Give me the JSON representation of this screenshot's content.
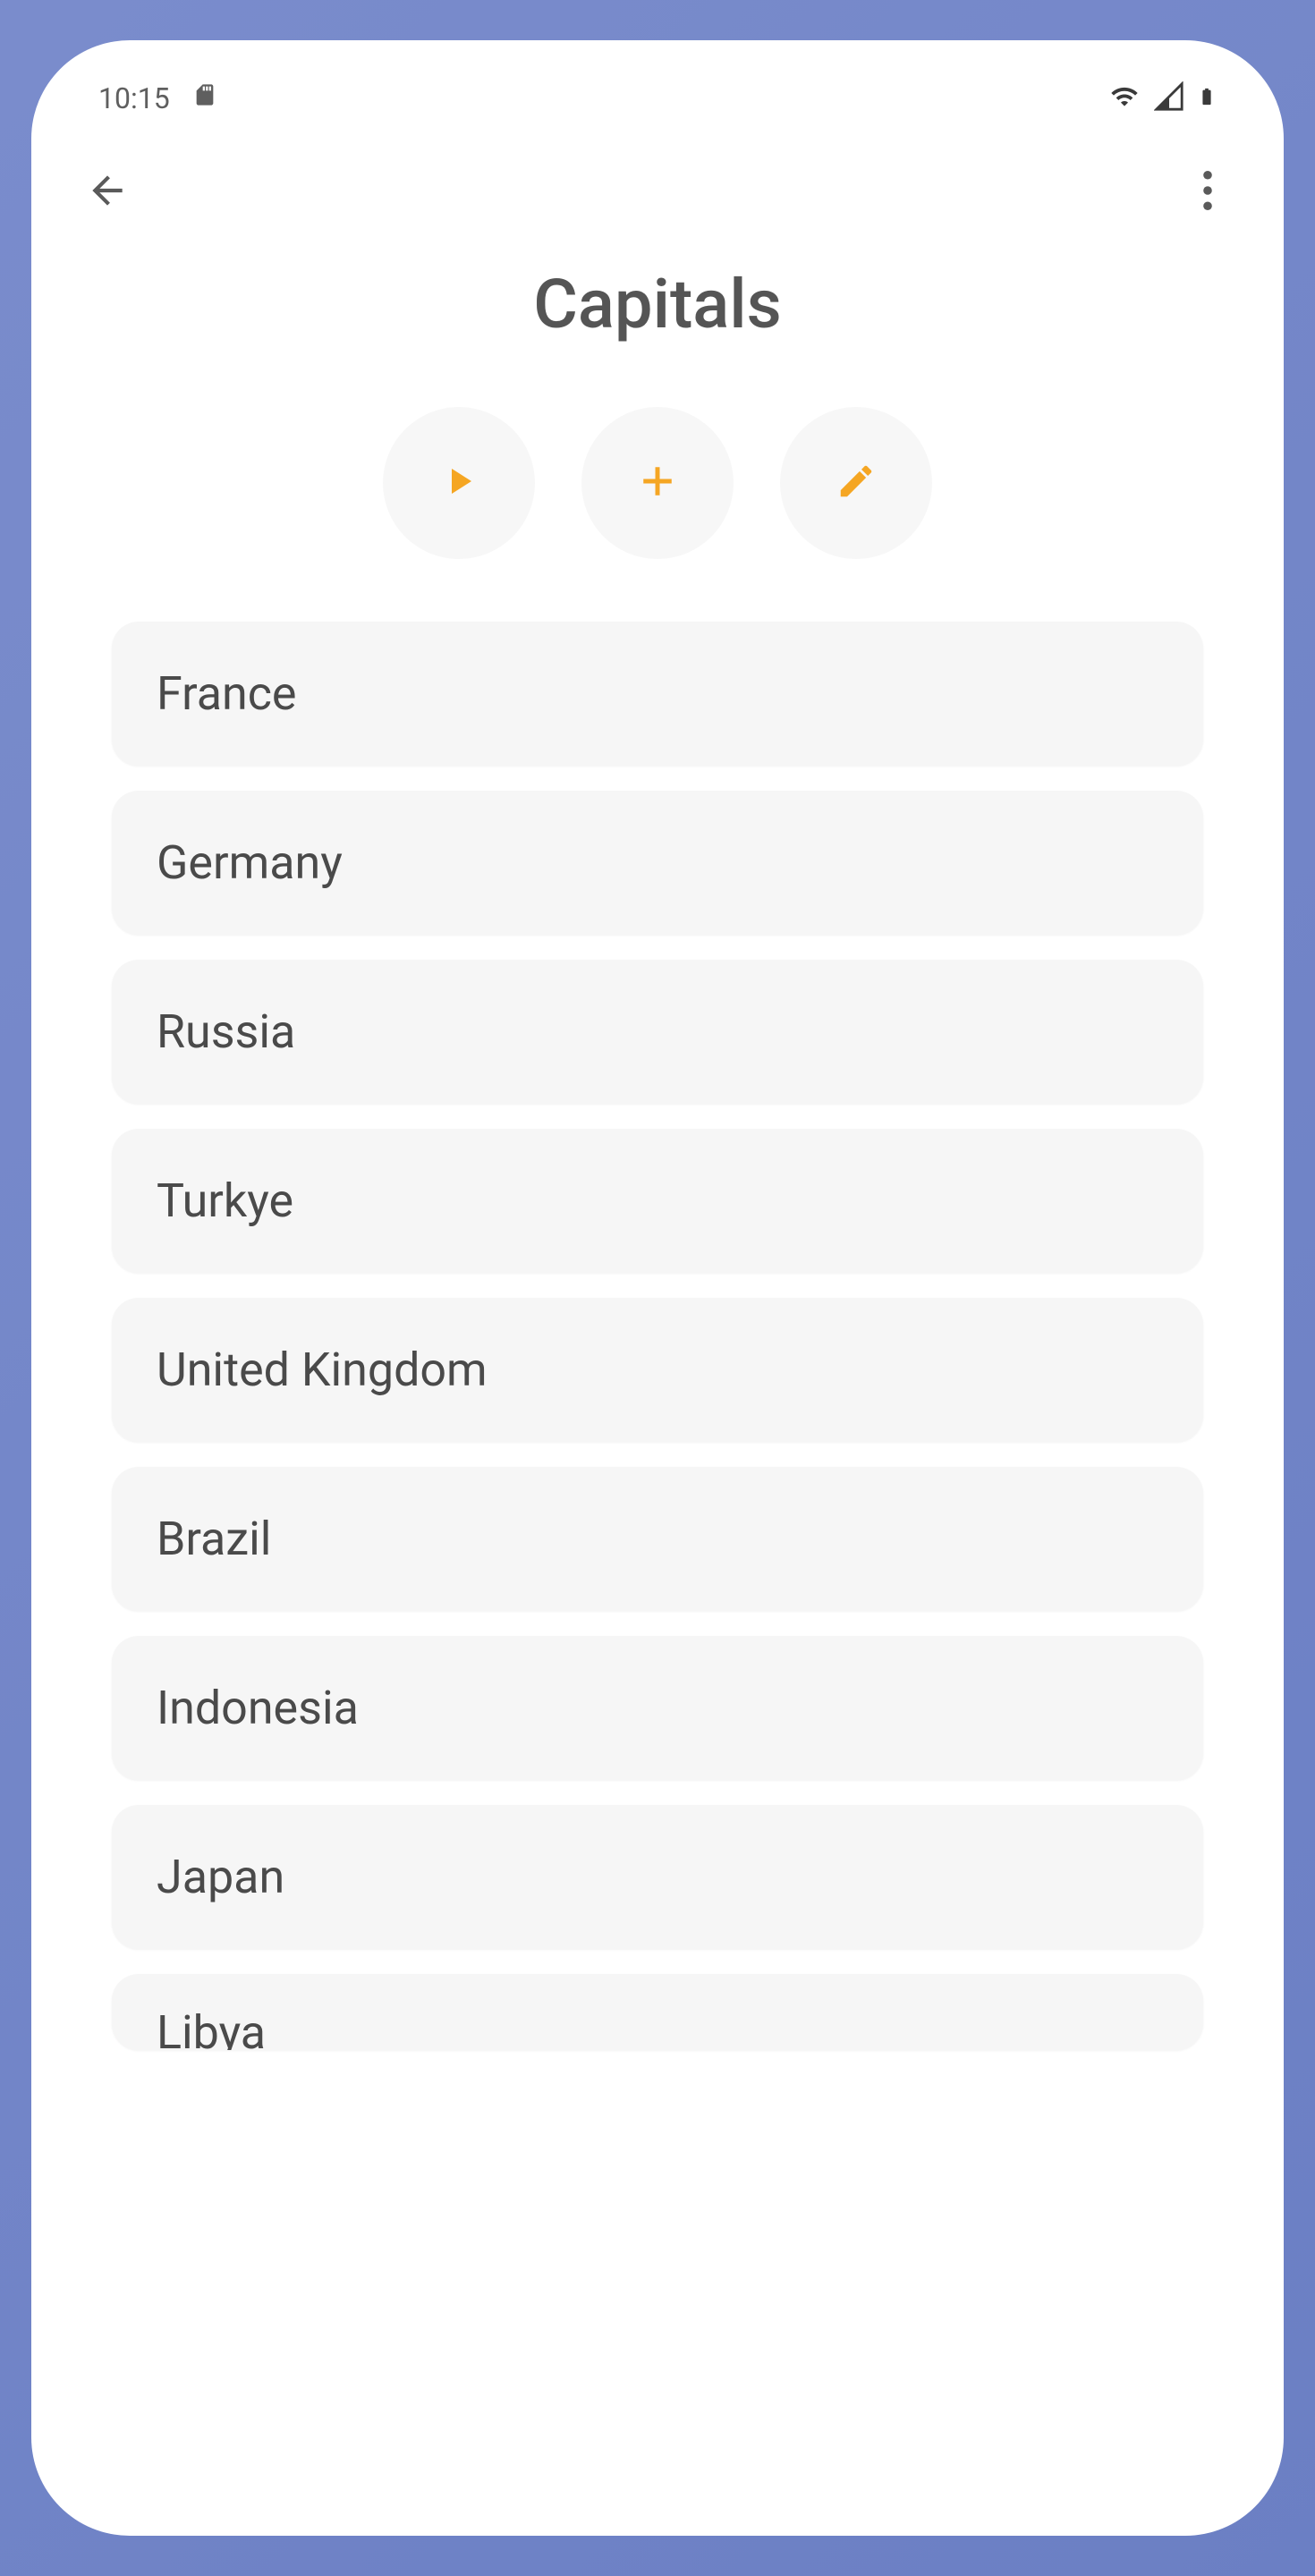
{
  "status": {
    "time": "10:15",
    "sd_icon": "sd-card-icon",
    "wifi_icon": "wifi-icon",
    "signal_icon": "cellular-signal-icon",
    "battery_icon": "battery-icon"
  },
  "header": {
    "back_icon": "back-arrow-icon",
    "more_icon": "more-vertical-icon",
    "title": "Capitals"
  },
  "actions": {
    "play_icon": "play-icon",
    "add_icon": "plus-icon",
    "edit_icon": "pencil-icon"
  },
  "items": [
    "France",
    "Germany",
    "Russia",
    "Turkye",
    "United Kingdom",
    "Brazil",
    "Indonesia",
    "Japan",
    "Libya"
  ],
  "colors": {
    "accent": "#f5a623"
  }
}
